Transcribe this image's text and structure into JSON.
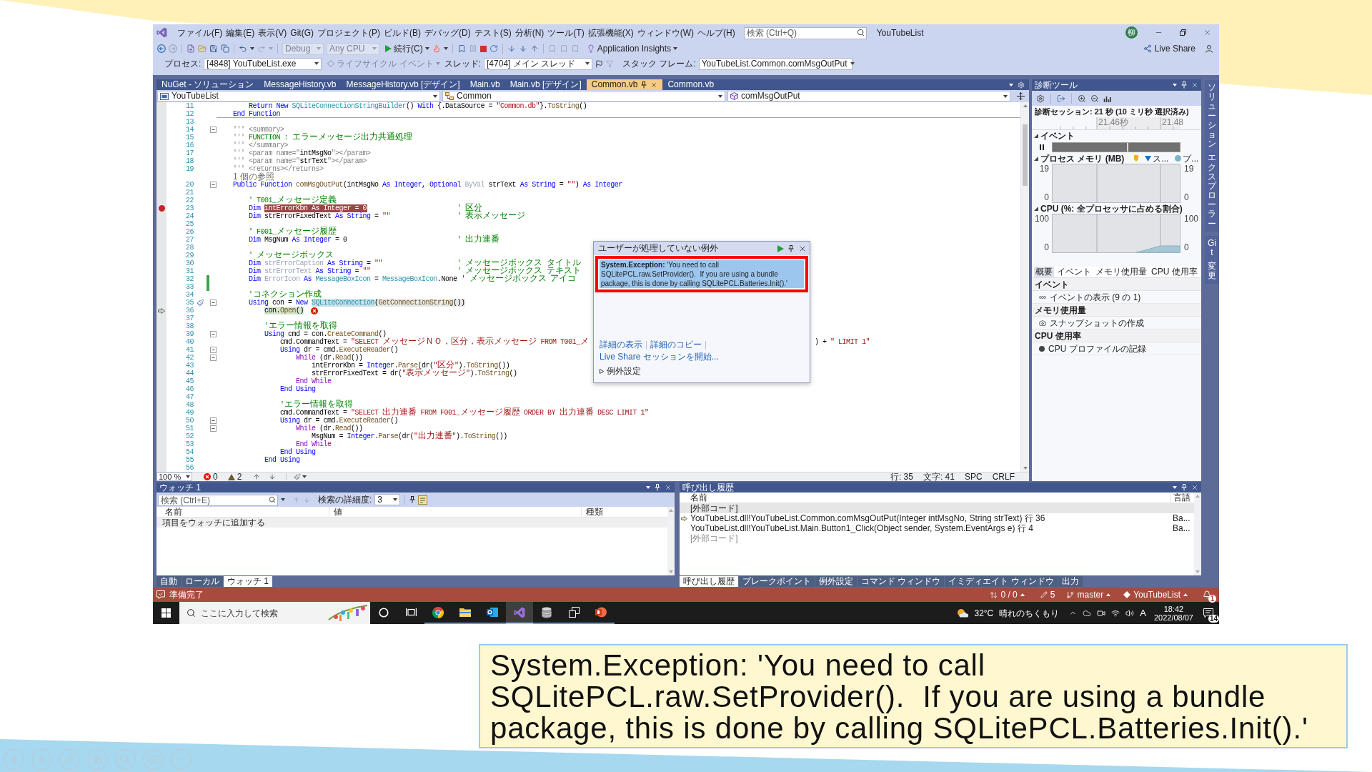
{
  "ide": {
    "title": "YouTubeList",
    "account": "柳",
    "menu": [
      "ファイル(F)",
      "編集(E)",
      "表示(V)",
      "Git(G)",
      "プロジェクト(P)",
      "ビルド(B)",
      "デバッグ(D)",
      "テスト(S)",
      "分析(N)",
      "ツール(T)",
      "拡張機能(X)",
      "ウィンドウ(W)",
      "ヘルプ(H)"
    ],
    "search": {
      "placeholder": "検索 (Ctrl+Q)"
    },
    "toolbar": {
      "configuration": {
        "label": "Debug",
        "disabled": true
      },
      "platform": {
        "label": "Any CPU",
        "disabled": true
      },
      "continue": "続行(C)",
      "insights": "Application Insights",
      "live_share": "Live Share"
    },
    "debug_location": {
      "process_label": "プロセス:",
      "process": "[4848] YouTubeList.exe",
      "lifecycle": {
        "label": "ライフサイクル イベント",
        "disabled": true
      },
      "thread_label": "スレッド:",
      "thread": "[4704] メイン スレッド",
      "frame_label": "スタック フレーム:",
      "frame": "YouTubeList.Common.comMsgOutPut"
    },
    "doc_tabs": [
      {
        "label": "NuGet - ソリューション",
        "selected": false
      },
      {
        "label": "MessageHistory.vb",
        "selected": false
      },
      {
        "label": "MessageHistory.vb [デザイン]",
        "selected": false
      },
      {
        "label": "Main.vb",
        "selected": false
      },
      {
        "label": "Main.vb [デザイン]",
        "selected": false
      },
      {
        "label": "Common.vb",
        "selected": true
      },
      {
        "label": "Common.vb",
        "selected": false
      }
    ],
    "navigation": {
      "project": "YouTubeList",
      "type": "Common",
      "member": "comMsgOutPut"
    },
    "code": [
      {
        "number": "11",
        "tokens": [
          {
            "kind": "keyword",
            "text": "        Return New "
          },
          {
            "kind": "type",
            "text": "SQLiteConnectionStringBuilder"
          },
          {
            "kind": "plain",
            "text": "() "
          },
          {
            "kind": "keyword",
            "text": "With"
          },
          {
            "kind": "plain",
            "text": " {.DataSource = "
          },
          {
            "kind": "string",
            "text": "\"Common.db\""
          },
          {
            "kind": "plain",
            "text": "}."
          },
          {
            "kind": "method",
            "text": "ToString"
          },
          {
            "kind": "plain",
            "text": "()"
          }
        ]
      },
      {
        "number": "12",
        "separator": true,
        "tokens": [
          {
            "kind": "keyword",
            "text": "    End Function"
          }
        ]
      },
      {
        "number": "13"
      },
      {
        "number": "14",
        "foldable": true,
        "tokens": [
          {
            "kind": "doc",
            "text": "    ''' <summary>"
          }
        ]
      },
      {
        "number": "15",
        "tokens": [
          {
            "kind": "doc",
            "text": "    ''' "
          },
          {
            "kind": "comment",
            "text": "FUNCTION : エラーメッセージ出力共通処理"
          }
        ]
      },
      {
        "number": "16",
        "tokens": [
          {
            "kind": "doc",
            "text": "    ''' </summary>"
          }
        ]
      },
      {
        "number": "17",
        "tokens": [
          {
            "kind": "doc",
            "text": "    ''' <param name=\""
          },
          {
            "kind": "plain",
            "text": "intMsgNo"
          },
          {
            "kind": "doc",
            "text": "\"></param>"
          }
        ]
      },
      {
        "number": "18",
        "tokens": [
          {
            "kind": "doc",
            "text": "    ''' <param name=\""
          },
          {
            "kind": "plain",
            "text": "strText"
          },
          {
            "kind": "doc",
            "text": "\"></param>"
          }
        ]
      },
      {
        "number": "19",
        "tokens": [
          {
            "kind": "doc",
            "text": "    ''' <returns></returns>"
          }
        ]
      },
      {
        "number": "20",
        "codelens": "1 個の参照",
        "foldable": true,
        "tokens": [
          {
            "kind": "keyword",
            "text": "    Public Function "
          },
          {
            "kind": "method",
            "text": "comMsgOutPut"
          },
          {
            "kind": "plain",
            "text": "(intMsgNo "
          },
          {
            "kind": "keyword",
            "text": "As Integer"
          },
          {
            "kind": "plain",
            "text": ", "
          },
          {
            "kind": "keyword",
            "text": "Optional "
          },
          {
            "kind": "faded",
            "text": "ByVal"
          },
          {
            "kind": "plain",
            "text": " strText "
          },
          {
            "kind": "keyword",
            "text": "As String"
          },
          {
            "kind": "plain",
            "text": " = "
          },
          {
            "kind": "string",
            "text": "\"\""
          },
          {
            "kind": "plain",
            "text": ") "
          },
          {
            "kind": "keyword",
            "text": "As Integer"
          }
        ]
      },
      {
        "number": "21"
      },
      {
        "number": "22",
        "tokens": [
          {
            "kind": "comment",
            "text": "        ' T001_メッセージ定義"
          }
        ]
      },
      {
        "number": "23",
        "glyph": {
          "kind": "breakpoint"
        },
        "tokens": [
          {
            "kind": "keyword",
            "text": "        Dim "
          },
          {
            "text": "intErrorKbn As Integer = 0",
            "highlight": {
              "kind": "breakpoint"
            }
          }
        ],
        "comment": "' 区分"
      },
      {
        "number": "24",
        "tokens": [
          {
            "kind": "keyword",
            "text": "        Dim "
          },
          {
            "kind": "plain",
            "text": "strErrorFixedText "
          },
          {
            "kind": "keyword",
            "text": "As String"
          },
          {
            "kind": "plain",
            "text": " = "
          },
          {
            "kind": "string",
            "text": "\"\""
          }
        ],
        "comment": "' 表示メッセージ"
      },
      {
        "number": "25"
      },
      {
        "number": "26",
        "tokens": [
          {
            "kind": "comment",
            "text": "        ' F001_メッセージ履歴"
          }
        ]
      },
      {
        "number": "27",
        "tokens": [
          {
            "kind": "keyword",
            "text": "        Dim "
          },
          {
            "kind": "plain",
            "text": "MsgNum "
          },
          {
            "kind": "keyword",
            "text": "As Integer"
          },
          {
            "kind": "plain",
            "text": " = 0"
          }
        ],
        "comment": "' 出力連番"
      },
      {
        "number": "28"
      },
      {
        "number": "29",
        "tokens": [
          {
            "kind": "comment",
            "text": "        ' メッセージボックス"
          }
        ]
      },
      {
        "number": "30",
        "tokens": [
          {
            "kind": "keyword",
            "text": "        Dim "
          },
          {
            "kind": "faded",
            "text": "strErrorCaption"
          },
          {
            "kind": "keyword",
            "text": " As String"
          },
          {
            "kind": "plain",
            "text": " = "
          },
          {
            "kind": "string",
            "text": "\"\""
          }
        ],
        "comment": "' メッセージボックス タイトル"
      },
      {
        "number": "31",
        "tokens": [
          {
            "kind": "keyword",
            "text": "        Dim "
          },
          {
            "kind": "faded",
            "text": "strErrorText"
          },
          {
            "kind": "keyword",
            "text": " As String"
          },
          {
            "kind": "plain",
            "text": " = "
          },
          {
            "kind": "string",
            "text": "\"\""
          }
        ],
        "comment": "' メッセージボックス テキスト"
      },
      {
        "number": "32",
        "changed": true,
        "tokens": [
          {
            "kind": "keyword",
            "text": "        Dim "
          },
          {
            "kind": "faded",
            "text": "ErrorIcon"
          },
          {
            "kind": "keyword",
            "text": " As "
          },
          {
            "kind": "type",
            "text": "MessageBoxIcon"
          },
          {
            "kind": "plain",
            "text": " = "
          },
          {
            "kind": "type",
            "text": "MessageBoxIcon"
          },
          {
            "kind": "plain",
            "text": ".None"
          }
        ],
        "comment": "' メッセージボックス アイコ"
      },
      {
        "number": "33",
        "changed": true
      },
      {
        "number": "34",
        "tokens": [
          {
            "kind": "comment",
            "text": "        'コネクション作成"
          }
        ]
      },
      {
        "number": "35",
        "glyph": {
          "kind": "quick_action"
        },
        "foldable": true,
        "tokens": [
          {
            "kind": "keyword",
            "text": "        Using "
          },
          {
            "kind": "plain",
            "text": "con = "
          },
          {
            "kind": "keyword",
            "text": "New "
          },
          {
            "kind": "type",
            "text": "SQLiteConnection",
            "highlight": {
              "kind": "reference"
            }
          },
          {
            "kind": "plain",
            "text": "(",
            "highlight": {
              "kind": "statement"
            }
          },
          {
            "kind": "method",
            "text": "GetConnectionString",
            "highlight": {
              "kind": "statement"
            }
          },
          {
            "kind": "plain",
            "text": "())",
            "highlight": {
              "kind": "statement"
            }
          }
        ]
      },
      {
        "number": "36",
        "glyph": {
          "kind": "current_statement"
        },
        "error": true,
        "tokens": [
          {
            "kind": "plain",
            "text": "            con.",
            "highlight": {
              "kind": "current"
            }
          },
          {
            "kind": "method",
            "text": "Open",
            "highlight": {
              "kind": "current"
            }
          },
          {
            "kind": "plain",
            "text": "()",
            "highlight": {
              "kind": "current"
            }
          }
        ]
      },
      {
        "number": "37"
      },
      {
        "number": "38",
        "tokens": [
          {
            "kind": "comment",
            "text": "            'エラー情報を取得"
          }
        ]
      },
      {
        "number": "39",
        "foldable": true,
        "tokens": [
          {
            "kind": "keyword",
            "text": "            Using "
          },
          {
            "kind": "plain",
            "text": "cmd = con."
          },
          {
            "kind": "method",
            "text": "CreateCommand"
          },
          {
            "kind": "plain",
            "text": "()"
          }
        ]
      },
      {
        "number": "40",
        "tokens": [
          {
            "kind": "plain",
            "text": "                cmd.CommandText = "
          },
          {
            "kind": "string",
            "text": "\"SELECT メッセージＮＯ，区分，表示メッセージ FROM T001_メ"
          }
        ],
        "tail": [
          {
            "kind": "plain",
            "text": ") + "
          },
          {
            "kind": "string",
            "text": "\" LIMIT 1\""
          }
        ]
      },
      {
        "number": "41",
        "foldable": true,
        "tokens": [
          {
            "kind": "keyword",
            "text": "                Using "
          },
          {
            "kind": "plain",
            "text": "dr = cmd."
          },
          {
            "kind": "method",
            "text": "ExecuteReader"
          },
          {
            "kind": "plain",
            "text": "()"
          }
        ]
      },
      {
        "number": "42",
        "foldable": true,
        "tokens": [
          {
            "kind": "control",
            "text": "                    While"
          },
          {
            "kind": "plain",
            "text": " (dr."
          },
          {
            "kind": "method",
            "text": "Read"
          },
          {
            "kind": "plain",
            "text": "())"
          }
        ]
      },
      {
        "number": "43",
        "tokens": [
          {
            "kind": "plain",
            "text": "                        intErrorKbn = "
          },
          {
            "kind": "keyword",
            "text": "Integer"
          },
          {
            "kind": "plain",
            "text": "."
          },
          {
            "kind": "method",
            "text": "Parse"
          },
          {
            "kind": "plain",
            "text": "(dr("
          },
          {
            "kind": "string",
            "text": "\"区分\""
          },
          {
            "kind": "plain",
            "text": ")."
          },
          {
            "kind": "method",
            "text": "ToString"
          },
          {
            "kind": "plain",
            "text": "())"
          }
        ]
      },
      {
        "number": "44",
        "tokens": [
          {
            "kind": "plain",
            "text": "                        strErrorFixedText = dr("
          },
          {
            "kind": "string",
            "text": "\"表示メッセージ\""
          },
          {
            "kind": "plain",
            "text": ")."
          },
          {
            "kind": "method",
            "text": "ToString"
          },
          {
            "kind": "plain",
            "text": "()"
          }
        ]
      },
      {
        "number": "45",
        "tokens": [
          {
            "kind": "control",
            "text": "                    End While"
          }
        ]
      },
      {
        "number": "46",
        "tokens": [
          {
            "kind": "keyword",
            "text": "                End Using"
          }
        ]
      },
      {
        "number": "47"
      },
      {
        "number": "48",
        "tokens": [
          {
            "kind": "comment",
            "text": "                'エラー情報を取得"
          }
        ]
      },
      {
        "number": "49",
        "tokens": [
          {
            "kind": "plain",
            "text": "                cmd.CommandText = "
          },
          {
            "kind": "string",
            "text": "\"SELECT 出力連番 FROM F001_メッセージ履歴 ORDER BY 出力連番 DESC LIMIT 1\""
          }
        ]
      },
      {
        "number": "50",
        "foldable": true,
        "tokens": [
          {
            "kind": "keyword",
            "text": "                Using "
          },
          {
            "kind": "plain",
            "text": "dr = cmd."
          },
          {
            "kind": "method",
            "text": "ExecuteReader"
          },
          {
            "kind": "plain",
            "text": "()"
          }
        ]
      },
      {
        "number": "51",
        "foldable": true,
        "tokens": [
          {
            "kind": "control",
            "text": "                    While"
          },
          {
            "kind": "plain",
            "text": " (dr."
          },
          {
            "kind": "method",
            "text": "Read"
          },
          {
            "kind": "plain",
            "text": "())"
          }
        ]
      },
      {
        "number": "52",
        "tokens": [
          {
            "kind": "plain",
            "text": "                        MsgNum = "
          },
          {
            "kind": "keyword",
            "text": "Integer"
          },
          {
            "kind": "plain",
            "text": "."
          },
          {
            "kind": "method",
            "text": "Parse"
          },
          {
            "kind": "plain",
            "text": "(dr("
          },
          {
            "kind": "string",
            "text": "\"出力連番\""
          },
          {
            "kind": "plain",
            "text": ")."
          },
          {
            "kind": "method",
            "text": "ToString"
          },
          {
            "kind": "plain",
            "text": "())"
          }
        ]
      },
      {
        "number": "53",
        "tokens": [
          {
            "kind": "control",
            "text": "                    End While"
          }
        ]
      },
      {
        "number": "54",
        "tokens": [
          {
            "kind": "keyword",
            "text": "                End Using"
          }
        ]
      },
      {
        "number": "55",
        "tokens": [
          {
            "kind": "keyword",
            "text": "            End Using"
          }
        ]
      },
      {
        "number": "56"
      }
    ],
    "exception": {
      "title": "ユーザーが処理していない例外",
      "message": "**System.Exception:** 'You need to call SQLitePCL.raw.SetProvider().  If you are using a bundle package, this is done by calling SQLitePCL.Batteries.Init().'",
      "selected": true,
      "links": [
        "詳細の表示",
        "詳細のコピー",
        "Live Share セッションを開始..."
      ],
      "settings": {
        "label": "例外設定",
        "expanded": false
      }
    },
    "editor_status": {
      "zoom": "100 %",
      "errors": "0",
      "warnings": "2",
      "line": "行: 35",
      "column": "文字: 41",
      "indent": "SPC",
      "line_ending": "CRLF"
    },
    "diagnostics": {
      "title": "診断ツール",
      "session": "診断セッション: 21 秒 (10 ミリ秒 選択済み)",
      "ruler": [
        "21.46秒",
        "21.48"
      ],
      "events": {
        "label": "イベント",
        "expanded": true
      },
      "memory": {
        "label": "プロセス メモリ (MB)",
        "expanded": true,
        "legend": [
          {
            "kind": "gc"
          },
          {
            "kind": "snapshot",
            "label": "ス..."
          },
          {
            "kind": "private_bytes",
            "label": "プ..."
          }
        ],
        "left_axis": [
          "19",
          "0"
        ],
        "right_axis": [
          "19",
          "0"
        ]
      },
      "cpu": {
        "label": "CPU (%: 全プロセッサに占める割合)",
        "expanded": true,
        "left_axis": [
          "100",
          "0"
        ],
        "right_axis": [
          "100",
          "0"
        ]
      },
      "tabs": [
        {
          "label": "概要",
          "selected": true
        },
        {
          "label": "イベント",
          "selected": false
        },
        {
          "label": "メモリ使用量",
          "selected": false
        },
        {
          "label": "CPU 使用率",
          "selected": false
        }
      ],
      "sections": [
        {
          "title": "イベント",
          "action": {
            "kind": "events",
            "label": "イベントの表示 (9 の 1)"
          }
        },
        {
          "title": "メモリ使用量",
          "action": {
            "kind": "snapshot",
            "label": "スナップショットの作成"
          }
        },
        {
          "title": "CPU 使用率",
          "action": {
            "kind": "record",
            "label": "CPU プロファイルの記録"
          }
        }
      ]
    },
    "side_tabs": [
      {
        "words": [
          "ソリューション",
          "エクスプローラー"
        ]
      },
      {
        "words": [
          "Git",
          "変更"
        ]
      }
    ],
    "watch": {
      "title": "ウォッチ 1",
      "search": {
        "placeholder": "検索 (Ctrl+E)"
      },
      "depth_label": "検索の詳細度:",
      "depth": "3",
      "columns": [
        "名前",
        "値",
        "種類"
      ],
      "rows": [
        {
          "name": "項目をウォッチに追加する",
          "selected": true
        }
      ],
      "tabs": [
        {
          "label": "自動",
          "selected": false
        },
        {
          "label": "ローカル",
          "selected": false
        },
        {
          "label": "ウォッチ 1",
          "selected": true
        }
      ]
    },
    "call_stack": {
      "title": "呼び出し履歴",
      "columns": [
        "名前",
        "言語"
      ],
      "rows": [
        {
          "name": "[外部コード]",
          "selected": true,
          "current": false,
          "dimmed": false
        },
        {
          "name": "YouTubeList.dll!YouTubeList.Common.comMsgOutPut(Integer intMsgNo, String strText) 行 36",
          "language": "Ba...",
          "selected": false,
          "current": true,
          "dimmed": false
        },
        {
          "name": "YouTubeList.dll!YouTubeList.Main.Button1_Click(Object sender, System.EventArgs e) 行 4",
          "language": "Ba...",
          "selected": false,
          "current": false,
          "dimmed": false
        },
        {
          "name": "[外部コード]",
          "selected": false,
          "current": false,
          "dimmed": true
        }
      ],
      "tabs": [
        {
          "label": "呼び出し履歴",
          "selected": true
        },
        {
          "label": "ブレークポイント",
          "selected": false
        },
        {
          "label": "例外設定",
          "selected": false
        },
        {
          "label": "コマンド ウィンドウ",
          "selected": false
        },
        {
          "label": "イミディエイト ウィンドウ",
          "selected": false
        },
        {
          "label": "出力",
          "selected": false
        }
      ]
    },
    "status_bar": {
      "text": "準備完了",
      "sync": "0 / 0",
      "edits": "5",
      "branch": "master",
      "repository": "YouTubeList",
      "notifications": "1"
    }
  },
  "taskbar": {
    "search": {
      "placeholder": "ここに入力して検索"
    },
    "apps": [
      {
        "kind": "cortana",
        "active": false,
        "running": false
      },
      {
        "kind": "task_view",
        "active": false,
        "running": false
      },
      {
        "kind": "chrome",
        "active": false,
        "running": true
      },
      {
        "kind": "explorer",
        "active": false,
        "running": true
      },
      {
        "kind": "outlook",
        "active": false,
        "running": true
      },
      {
        "kind": "visual_studio",
        "active": true,
        "running": true
      },
      {
        "kind": "database",
        "active": false,
        "running": true
      },
      {
        "kind": "windows",
        "active": false,
        "running": true
      },
      {
        "kind": "powerpoint",
        "active": false,
        "running": true
      }
    ],
    "weather": {
      "temperature": "32°C",
      "condition": "晴れのちくもり"
    },
    "input_mode": "A",
    "time": "18:42",
    "date": "2022/08/07",
    "notifications": "14"
  },
  "caption": "System.Exception: 'You need to call SQLitePCL.raw.SetProvider().  If you are using a bundle package, this is done by calling SQLitePCL.Batteries.Init().'"
}
